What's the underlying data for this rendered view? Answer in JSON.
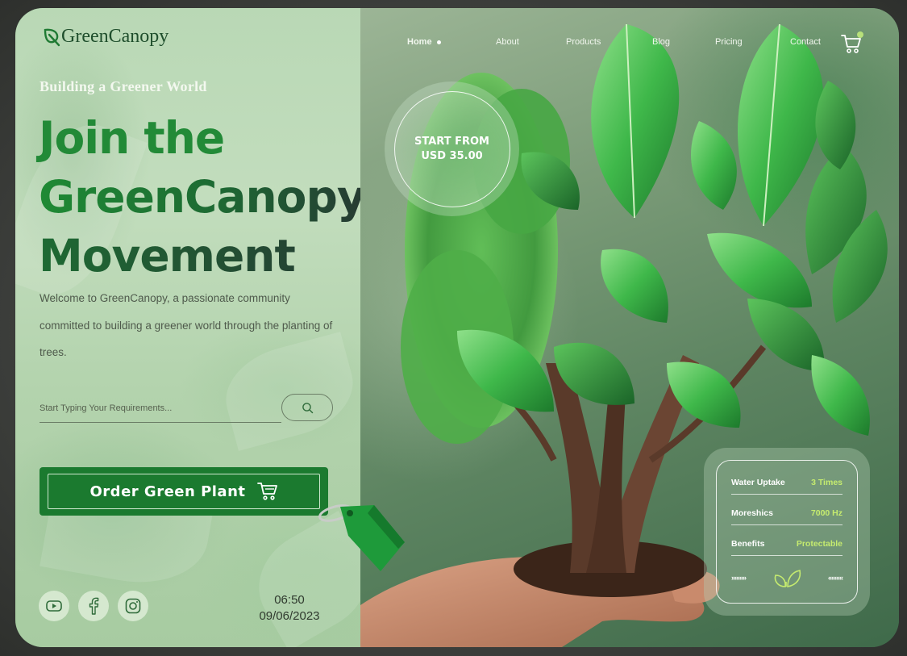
{
  "brand": {
    "name": "GreenCanopy"
  },
  "hero": {
    "tagline": "Building a Greener World",
    "headline": [
      "Join the",
      "GreenCanopy",
      "Movement"
    ],
    "description": "Welcome to GreenCanopy, a passionate community committed to building a greener world through the planting of trees."
  },
  "search": {
    "placeholder": "Start Typing Your Requirements..."
  },
  "cta": {
    "order_label": "Order Green Plant"
  },
  "nav": {
    "items": [
      "Home",
      "About",
      "Products",
      "Blog",
      "Pricing",
      "Contact"
    ],
    "active": "Home"
  },
  "price": {
    "line1": "START FROM",
    "line2": "USD 35.00"
  },
  "stats": [
    {
      "label": "Water Uptake",
      "value": "3 Times"
    },
    {
      "label": "Moreshics",
      "value": "7000 Hz"
    },
    {
      "label": "Benefits",
      "value": "Protectable"
    }
  ],
  "stats_arrows": {
    "left": "›››››››››",
    "right": "‹‹‹‹‹‹‹‹‹"
  },
  "socials": [
    "youtube-icon",
    "facebook-icon",
    "instagram-icon"
  ],
  "datetime": {
    "time": "06:50",
    "date": "09/06/2023"
  },
  "colors": {
    "accent": "#1b7a2f",
    "stat_value": "#c5eb6f",
    "headline_start": "#228a37",
    "headline_end": "#263b33"
  }
}
